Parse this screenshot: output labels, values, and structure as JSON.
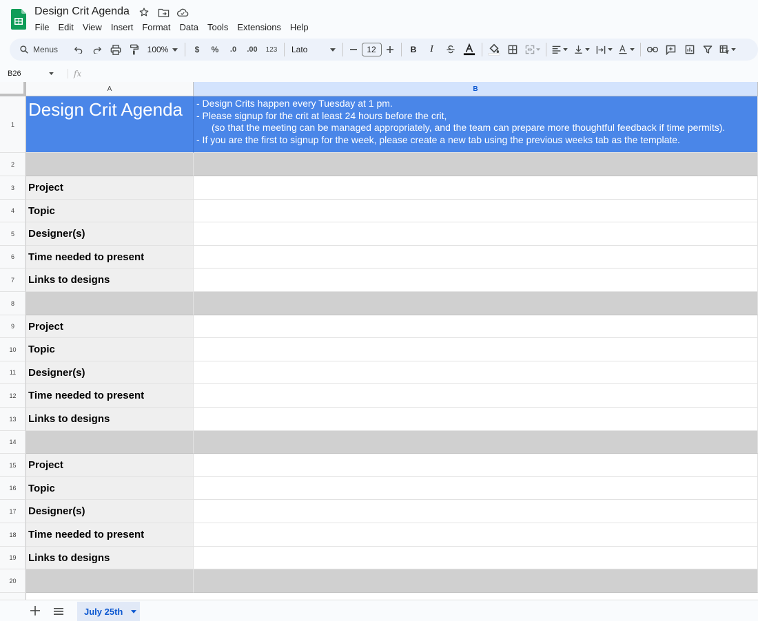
{
  "app": {
    "doc_title": "Design Crit Agenda",
    "menu": [
      "File",
      "Edit",
      "View",
      "Insert",
      "Format",
      "Data",
      "Tools",
      "Extensions",
      "Help"
    ]
  },
  "toolbar": {
    "menus_label": "Menus",
    "zoom": "100%",
    "currency": "$",
    "percent": "%",
    "dec_decrease": ".0",
    "dec_increase": ".00",
    "number_format": "123",
    "font": "Lato",
    "font_size": "12",
    "bold": "B",
    "italic": "I"
  },
  "formula_bar": {
    "name_box": "B26",
    "fx": "fx"
  },
  "columns": [
    "A",
    "B"
  ],
  "rows": [
    {
      "n": "1",
      "type": "header"
    },
    {
      "n": "2",
      "type": "sep"
    },
    {
      "n": "3",
      "type": "label",
      "label": "Project"
    },
    {
      "n": "4",
      "type": "label",
      "label": "Topic"
    },
    {
      "n": "5",
      "type": "label",
      "label": "Designer(s)"
    },
    {
      "n": "6",
      "type": "label",
      "label": "Time needed to present"
    },
    {
      "n": "7",
      "type": "label",
      "label": "Links to designs"
    },
    {
      "n": "8",
      "type": "sep"
    },
    {
      "n": "9",
      "type": "label",
      "label": "Project"
    },
    {
      "n": "10",
      "type": "label",
      "label": "Topic"
    },
    {
      "n": "11",
      "type": "label",
      "label": "Designer(s)"
    },
    {
      "n": "12",
      "type": "label",
      "label": "Time needed to present"
    },
    {
      "n": "13",
      "type": "label",
      "label": "Links to designs"
    },
    {
      "n": "14",
      "type": "sep"
    },
    {
      "n": "15",
      "type": "label",
      "label": "Project"
    },
    {
      "n": "16",
      "type": "label",
      "label": "Topic"
    },
    {
      "n": "17",
      "type": "label",
      "label": "Designer(s)"
    },
    {
      "n": "18",
      "type": "label",
      "label": "Time needed to present"
    },
    {
      "n": "19",
      "type": "label",
      "label": "Links to designs"
    },
    {
      "n": "20",
      "type": "sep"
    }
  ],
  "header_cell": {
    "title": "Design Crit Agenda",
    "line1": "- Design Crits happen every Tuesday at 1 pm.",
    "line2": "- Please signup for the crit at least 24 hours before the crit,",
    "line3": "(so that the meeting can be managed appropriately, and the team can prepare more thoughtful feedback if time permits).",
    "line4": "- If you are the first to signup for the week, please create a new tab using the previous weeks tab as the template."
  },
  "sheets": {
    "active": "July 25th"
  },
  "colors": {
    "header_blue": "#4a86e8",
    "label_gray": "#efefef",
    "separator_gray": "#d0d0d0",
    "accent": "#0b57d0",
    "sheets_green": "#0f9d58"
  }
}
